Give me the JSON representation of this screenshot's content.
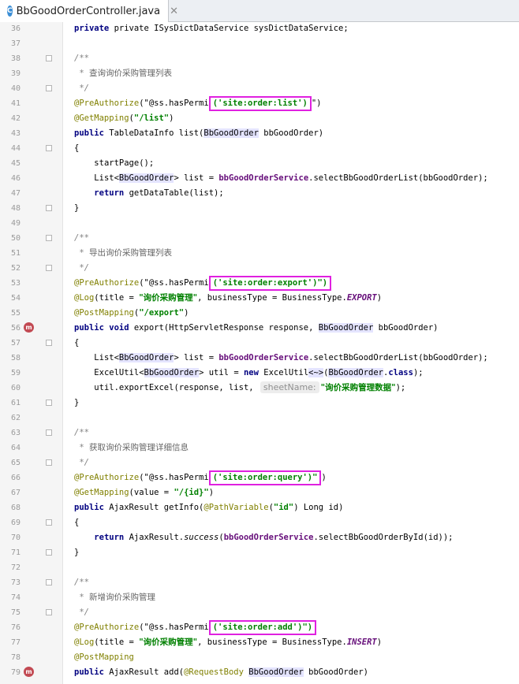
{
  "tab": {
    "icon_letter": "C",
    "title": "BbGoodOrderController.java",
    "close": "✕"
  },
  "line_numbers": [
    "36",
    "37",
    "38",
    "39",
    "40",
    "41",
    "42",
    "43",
    "44",
    "45",
    "46",
    "47",
    "48",
    "49",
    "50",
    "51",
    "52",
    "53",
    "54",
    "55",
    "56",
    "57",
    "58",
    "59",
    "60",
    "61",
    "62",
    "63",
    "64",
    "65",
    "66",
    "67",
    "68",
    "69",
    "70",
    "71",
    "72",
    "73",
    "74",
    "75",
    "76",
    "77",
    "78",
    "79"
  ],
  "code": {
    "l36": "private ISysDictDataService sysDictDataService;",
    "javadoc_open": "/**",
    "javadoc_star": " * ",
    "javadoc_close": " */",
    "l38_comment": "查询询价采购管理列表",
    "l40_pre": "@PreAuthorize",
    "l40_mid": "(\"@ss.hasPermi",
    "l40_box": "('site:order:list')",
    "l40_end": "\")",
    "l41_ann": "@GetMapping",
    "l41_str": "\"/list\"",
    "l42_a": "public ",
    "l42_b": "TableDataInfo list(",
    "l42_c": "BbGoodOrder",
    "l42_d": " bbGoodOrder)",
    "brace_open": "{",
    "brace_close": "}",
    "l44": "startPage();",
    "l45_a": "List<",
    "l45_b": "BbGoodOrder",
    "l45_c": "> list = ",
    "l45_d": "bbGoodOrderService",
    "l45_e": ".selectBbGoodOrderList(bbGoodOrder);",
    "l46_kw": "return ",
    "l46_rest": "getDataTable(list);",
    "l50_comment": "导出询价采购管理列表",
    "l52_box": "('site:order:export')\")",
    "l53_ann": "@Log",
    "l53_a": "(title = ",
    "l53_str": "\"询价采购管理\"",
    "l53_b": ", businessType = BusinessType.",
    "l53_const": "EXPORT",
    "l53_c": ")",
    "l54_ann": "@PostMapping",
    "l54_str": "\"/export\"",
    "l55_a": "public void ",
    "l55_b": "export(HttpServletResponse response, ",
    "l55_c": "BbGoodOrder",
    "l55_d": " bbGoodOrder)",
    "l58_a": "ExcelUtil<",
    "l58_b": "BbGoodOrder",
    "l58_c": "> util = ",
    "l58_new": "new ",
    "l58_d": "ExcelUtil",
    "l58_e": "<~>",
    "l58_f": "(",
    "l58_g": "BbGoodOrder",
    "l58_h": ".",
    "l58_class": "class",
    "l58_i": ");",
    "l59_a": "util.exportExcel(response, list, ",
    "l59_hint": "sheetName:",
    "l59_str": "\"询价采购管理数据\"",
    "l59_b": ");",
    "l63_comment": "获取询价采购管理详细信息",
    "l65_box": "('site:order:query')\"",
    "l65_end": ")",
    "l66_ann": "@GetMapping",
    "l66_a": "(value = ",
    "l66_str": "\"/{id}\"",
    "l66_b": ")",
    "l67_a": "public ",
    "l67_b": "AjaxResult getInfo(",
    "l67_ann": "@PathVariable",
    "l67_c": "(",
    "l67_str": "\"id\"",
    "l67_d": ") Long id)",
    "l69_kw": "return ",
    "l69_a": "AjaxResult.",
    "l69_it": "success",
    "l69_b": "(",
    "l69_fld": "bbGoodOrderService",
    "l69_c": ".selectBbGoodOrderById(id));",
    "l73_comment": "新增询价采购管理",
    "l75_box": "('site:order:add')\")",
    "l76_const": "INSERT",
    "l77_ann": "@PostMapping",
    "l78_a": "public ",
    "l78_b": "AjaxResult add(",
    "l78_ann": "@RequestBody ",
    "l78_c": "BbGoodOrder",
    "l78_d": " bbGoodOrder)"
  },
  "gutter_marks": {
    "mark": "m"
  }
}
